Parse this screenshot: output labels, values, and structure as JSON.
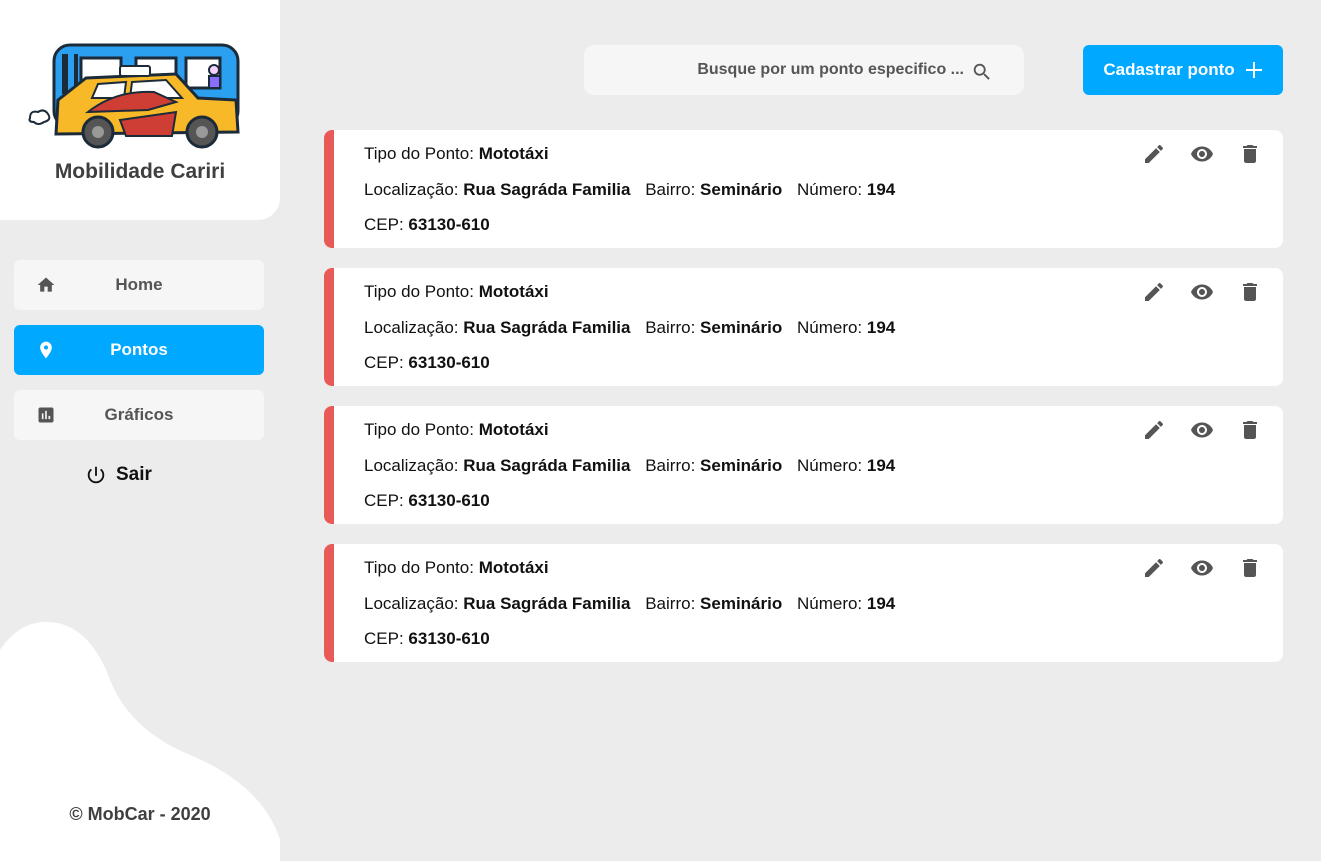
{
  "sidebar": {
    "app_name": "Mobilidade Cariri",
    "logo_icon": "bus-car-logo-icon",
    "nav": [
      {
        "label": "Home",
        "icon": "home-icon",
        "active": false
      },
      {
        "label": "Pontos",
        "icon": "map-pin-icon",
        "active": true
      },
      {
        "label": "Gráficos",
        "icon": "bar-chart-icon",
        "active": false
      }
    ],
    "logout_label": "Sair",
    "logout_icon": "power-icon",
    "footer": "© MobCar - 2020"
  },
  "header": {
    "search_placeholder": "Busque por um ponto especifico ...",
    "search_value": "",
    "add_button_label": "Cadastrar ponto",
    "add_icon": "plus-icon"
  },
  "colors": {
    "accent_blue": "#00a8ff",
    "card_accent_red": "#e85a57",
    "background": "#ececec"
  },
  "labels": {
    "tipo": "Tipo do Ponto:",
    "localizacao": "Localização:",
    "bairro": "Bairro:",
    "numero": "Número:",
    "cep": "CEP:"
  },
  "points": [
    {
      "tipo": "Mototáxi",
      "localizacao": "Rua Sagráda Familia",
      "bairro": "Seminário",
      "numero": "194",
      "cep": "63130-610"
    },
    {
      "tipo": "Mototáxi",
      "localizacao": "Rua Sagráda Familia",
      "bairro": "Seminário",
      "numero": "194",
      "cep": "63130-610"
    },
    {
      "tipo": "Mototáxi",
      "localizacao": "Rua Sagráda Familia",
      "bairro": "Seminário",
      "numero": "194",
      "cep": "63130-610"
    },
    {
      "tipo": "Mototáxi",
      "localizacao": "Rua Sagráda Familia",
      "bairro": "Seminário",
      "numero": "194",
      "cep": "63130-610"
    }
  ],
  "card_actions": [
    "edit-icon",
    "view-icon",
    "delete-icon"
  ]
}
